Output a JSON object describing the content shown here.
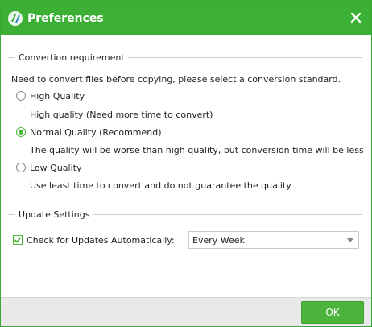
{
  "window": {
    "title": "Preferences",
    "accent_color": "#3bb034",
    "close_icon": "close-icon",
    "app_icon": "app-logo-icon"
  },
  "conversion": {
    "legend": "Convertion requirement",
    "instruction": "Need to convert files before copying, please select a conversion standard.",
    "options": [
      {
        "label": "High Quality",
        "description": "High quality (Need more time to convert)",
        "selected": false
      },
      {
        "label": "Normal Quality (Recommend)",
        "description": "The quality will be worse than high quality, but conversion time will be less",
        "selected": true
      },
      {
        "label": "Low Quality",
        "description": "Use least time to convert and do not guarantee the quality",
        "selected": false
      }
    ]
  },
  "update": {
    "legend": "Update Settings",
    "check_label": "Check for Updates Automatically:",
    "check_checked": true,
    "frequency_value": "Every Week"
  },
  "footer": {
    "ok_label": "OK"
  }
}
